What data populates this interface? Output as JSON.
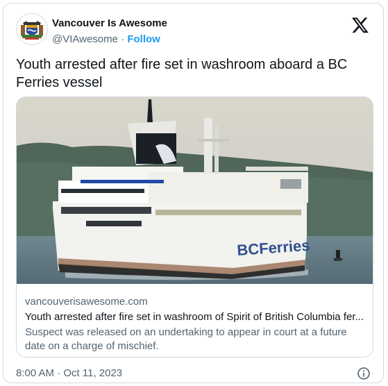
{
  "author": {
    "name": "Vancouver Is Awesome",
    "handle": "@VIAwesome",
    "separator": "·",
    "follow_label": "Follow"
  },
  "tweet": {
    "text": "Youth arrested after fire set in washroom aboard a BC Ferries vessel"
  },
  "link_card": {
    "domain": "vancouverisawesome.com",
    "title": "Youth arrested after fire set in washroom of Spirit of British Columbia fer...",
    "description": "Suspect was released on an undertaking to appear in court at a future date on a charge of mischief.",
    "image_text": "BCFerries"
  },
  "timestamp": "8:00 AM · Oct 11, 2023",
  "icons": {
    "platform": "x-logo-icon",
    "info": "info-icon",
    "avatar": "coat-of-arms-icon"
  },
  "colors": {
    "link_blue": "#1d9bf0",
    "secondary_text": "#536471",
    "border": "#cfd9de"
  }
}
